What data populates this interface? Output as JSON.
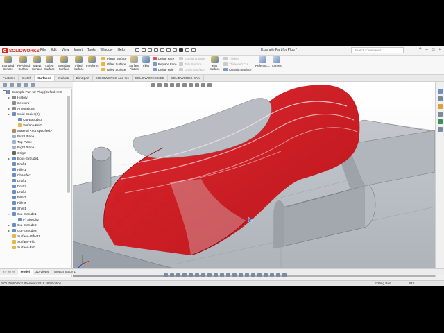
{
  "app": {
    "logo_text": "SOLIDWORKS",
    "document_title": "Example Part for Plug *",
    "search_placeholder": "Search Commands",
    "menu": [
      "File",
      "Edit",
      "View",
      "Insert",
      "Tools",
      "Window",
      "Help"
    ]
  },
  "colors": {
    "brand": "#d9261c",
    "model_red": "#cc1b22",
    "model_grey": "#a9aeb6"
  },
  "ribbon": {
    "big": [
      {
        "l1": "Extruded",
        "l2": "Surface",
        "icon": "extruded-surface-icon"
      },
      {
        "l1": "Revolved",
        "l2": "Surface",
        "icon": "revolved-surface-icon"
      },
      {
        "l1": "Swept",
        "l2": "Surface",
        "icon": "swept-surface-icon"
      },
      {
        "l1": "Lofted",
        "l2": "Surface",
        "icon": "lofted-surface-icon"
      },
      {
        "l1": "Boundary",
        "l2": "Surface",
        "icon": "boundary-surface-icon"
      },
      {
        "l1": "Filled",
        "l2": "Surface",
        "icon": "filled-surface-icon"
      },
      {
        "l1": "Freeform",
        "l2": "",
        "icon": "freeform-icon"
      }
    ],
    "col1": [
      "Planar Surface",
      "Offset Surface",
      "Ruled Surface"
    ],
    "surface_flatten": {
      "l1": "Surface",
      "l2": "Flatten"
    },
    "fillet": "Fillet",
    "col2": [
      "Delete Face",
      "Replace Face",
      "Delete Hole"
    ],
    "col3": [
      "Extend Surface",
      "Trim Surface",
      "Untrim Surface"
    ],
    "knit": {
      "l1": "Knit",
      "l2": "Surface"
    },
    "col4": [
      "Thicken",
      "Thickened Cut",
      "Cut With Surface"
    ],
    "reference": "Referenc...",
    "curves": "Curves"
  },
  "tabs": [
    "Features",
    "Sketch",
    "Surfaces",
    "Evaluate",
    "DimXpert",
    "SOLIDWORKS Add-Ins",
    "SOLIDWORKS MBD",
    "SOLIDWORKS CAM"
  ],
  "active_tab": "Surfaces",
  "tree": [
    {
      "label": "Example Part for Plug  (Default<<D",
      "icon": "part-icon",
      "level": 0,
      "exp": ""
    },
    {
      "label": "History",
      "icon": "history-icon",
      "level": 1,
      "exp": "▸"
    },
    {
      "label": "Sensors",
      "icon": "sensors-icon",
      "level": 1,
      "exp": ""
    },
    {
      "label": "Annotations",
      "icon": "annotations-icon",
      "level": 1,
      "exp": "▸"
    },
    {
      "label": "Solid Bodies(2)",
      "icon": "solid-bodies-icon",
      "level": 1,
      "exp": "▸"
    },
    {
      "label": "Cut-Extrude3",
      "icon": "cut-extrude-icon",
      "level": 2,
      "exp": ""
    },
    {
      "label": "Surface-Knit3",
      "icon": "surface-knit-icon",
      "level": 2,
      "exp": ""
    },
    {
      "label": "Material <not specified>",
      "icon": "material-icon",
      "level": 1,
      "exp": ""
    },
    {
      "label": "Front Plane",
      "icon": "plane-icon",
      "level": 1,
      "exp": ""
    },
    {
      "label": "Top Plane",
      "icon": "plane-icon",
      "level": 1,
      "exp": ""
    },
    {
      "label": "Right Plane",
      "icon": "plane-icon",
      "level": 1,
      "exp": ""
    },
    {
      "label": "Origin",
      "icon": "origin-icon",
      "level": 1,
      "exp": ""
    },
    {
      "label": "Boss-Extrude1",
      "icon": "boss-extrude-icon",
      "level": 1,
      "exp": "▸"
    },
    {
      "label": "Draft4",
      "icon": "draft-icon",
      "level": 1,
      "exp": ""
    },
    {
      "label": "Fillet1",
      "icon": "fillet-icon",
      "level": 1,
      "exp": ""
    },
    {
      "label": "Chamfer1",
      "icon": "chamfer-icon",
      "level": 1,
      "exp": ""
    },
    {
      "label": "Draft1",
      "icon": "draft-icon",
      "level": 1,
      "exp": ""
    },
    {
      "label": "Draft2",
      "icon": "draft-icon",
      "level": 1,
      "exp": ""
    },
    {
      "label": "Draft3",
      "icon": "draft-icon",
      "level": 1,
      "exp": ""
    },
    {
      "label": "Fillet2",
      "icon": "fillet-icon",
      "level": 1,
      "exp": ""
    },
    {
      "label": "Fillet3",
      "icon": "fillet-icon",
      "level": 1,
      "exp": ""
    },
    {
      "label": "Shell1",
      "icon": "shell-icon",
      "level": 1,
      "exp": ""
    },
    {
      "label": "Cut-Extrude1",
      "icon": "cut-extrude-icon",
      "level": 1,
      "exp": "▾"
    },
    {
      "label": "(-) Sketch2",
      "icon": "sketch-icon",
      "level": 2,
      "exp": ""
    },
    {
      "label": "Cut-Extrude2",
      "icon": "cut-extrude-icon",
      "level": 1,
      "exp": "▸"
    },
    {
      "label": "Cut-Extrude3",
      "icon": "cut-extrude-icon",
      "level": 1,
      "exp": "▸"
    },
    {
      "label": "Surface-Offset1",
      "icon": "surface-offset-icon",
      "level": 1,
      "exp": ""
    },
    {
      "label": "Surface-Fill1",
      "icon": "surface-fill-icon",
      "level": 1,
      "exp": ""
    },
    {
      "label": "Surface-Fill2",
      "icon": "surface-fill-icon",
      "level": 1,
      "exp": ""
    }
  ],
  "bottom_tabs": [
    "Model",
    "3D Views",
    "Motion Study 1"
  ],
  "active_bottom_tab": "Model",
  "status": {
    "left": "SOLIDWORKS Premium 2018 x64 Edition",
    "mode": "Editing Part",
    "units": "IPS"
  }
}
